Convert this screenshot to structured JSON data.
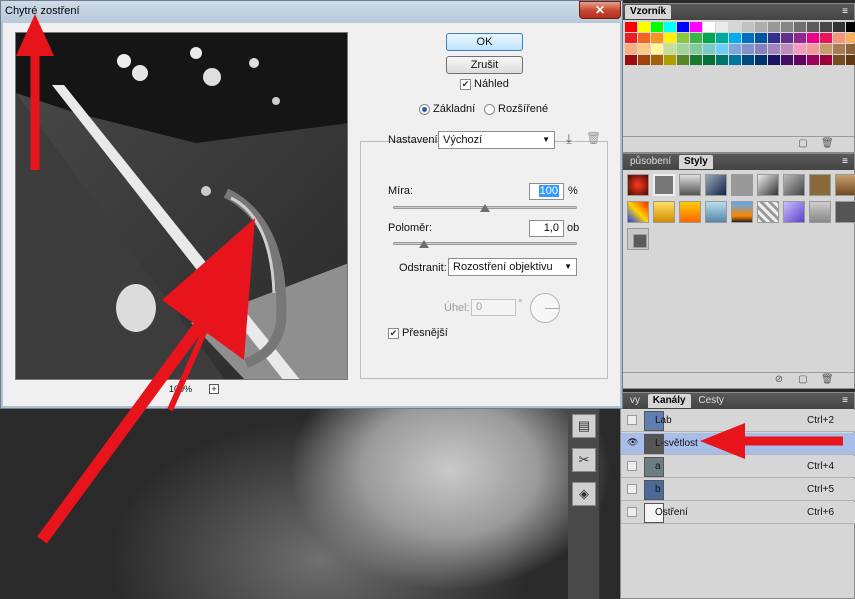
{
  "dialog": {
    "title": "Chytré zostření",
    "close_symbol": "✕",
    "ok_label": "OK",
    "cancel_label": "Zrušit",
    "preview_label": "Náhled",
    "preview_checked": true,
    "zoom_level": "100%",
    "zoom_plus": "+",
    "mode_basic": "Základní",
    "mode_advanced": "Rozšířené",
    "mode_selected": "Základní",
    "settings_label": "Nastavení:",
    "settings_value": "Výchozí",
    "amount_label": "Míra:",
    "amount_value": "100",
    "amount_unit": "%",
    "amount_fraction": 0.5,
    "radius_label": "Poloměr:",
    "radius_value": "1,0",
    "radius_unit": "ob",
    "radius_fraction": 0.17,
    "remove_label": "Odstranit:",
    "remove_value": "Rozostření objektivu",
    "angle_label": "Úhel:",
    "angle_value": "0",
    "angle_unit": "°",
    "more_accurate_label": "Přesnější",
    "more_accurate_checked": true
  },
  "swatches_panel": {
    "tab_label": "Vzorník",
    "menu_icon": "≡",
    "colors": [
      [
        "#ff0000",
        "#ffff00",
        "#00ff00",
        "#00ffff",
        "#0000ff",
        "#ff00ff",
        "#ffffff",
        "#ebebeb",
        "#d6d6d6",
        "#c2c2c2",
        "#adadad",
        "#999999",
        "#858585",
        "#707070",
        "#5c5c5c",
        "#474747",
        "#333333",
        "#000000"
      ],
      [
        "#ee1c24",
        "#f26522",
        "#f7941d",
        "#fff200",
        "#8dc63f",
        "#39b54a",
        "#00a651",
        "#00a99d",
        "#00aeef",
        "#0072bc",
        "#0054a6",
        "#2e3192",
        "#662d91",
        "#92278f",
        "#ec008c",
        "#ed145b",
        "#f69679",
        "#fbaf5d"
      ],
      [
        "#f9ad81",
        "#fdc689",
        "#fff799",
        "#c4df9b",
        "#a3d39c",
        "#82ca9c",
        "#7accc8",
        "#6dcff6",
        "#7da7d9",
        "#8393ca",
        "#8781bd",
        "#a186be",
        "#bd8cbf",
        "#f49ac1",
        "#f5989d",
        "#c69c6d",
        "#a67c52",
        "#8c6239"
      ],
      [
        "#9e0b0f",
        "#a0410d",
        "#a36209",
        "#aba000",
        "#598527",
        "#197b30",
        "#007236",
        "#00746b",
        "#0076a3",
        "#004b80",
        "#003471",
        "#1b1464",
        "#440e62",
        "#630460",
        "#9e005d",
        "#9e0039",
        "#754c24",
        "#603913"
      ]
    ]
  },
  "styles_panel": {
    "tab_inactive": "působení",
    "tab_active": "Styly",
    "menu_icon": "≡"
  },
  "channels_panel": {
    "tab_layers": "vy",
    "tab_channels": "Kanály",
    "tab_paths": "Cesty",
    "menu_icon": "≡",
    "rows": [
      {
        "name": "Lab",
        "shortcut": "Ctrl+2",
        "visible": false,
        "selected": false
      },
      {
        "name": "L-světlost",
        "shortcut": "",
        "visible": true,
        "selected": true
      },
      {
        "name": "a",
        "shortcut": "Ctrl+4",
        "visible": false,
        "selected": false
      },
      {
        "name": "b",
        "shortcut": "Ctrl+5",
        "visible": false,
        "selected": false
      },
      {
        "name": "Ostření",
        "shortcut": "Ctrl+6",
        "visible": false,
        "selected": false
      }
    ]
  },
  "annotation_color": "#e8141c"
}
